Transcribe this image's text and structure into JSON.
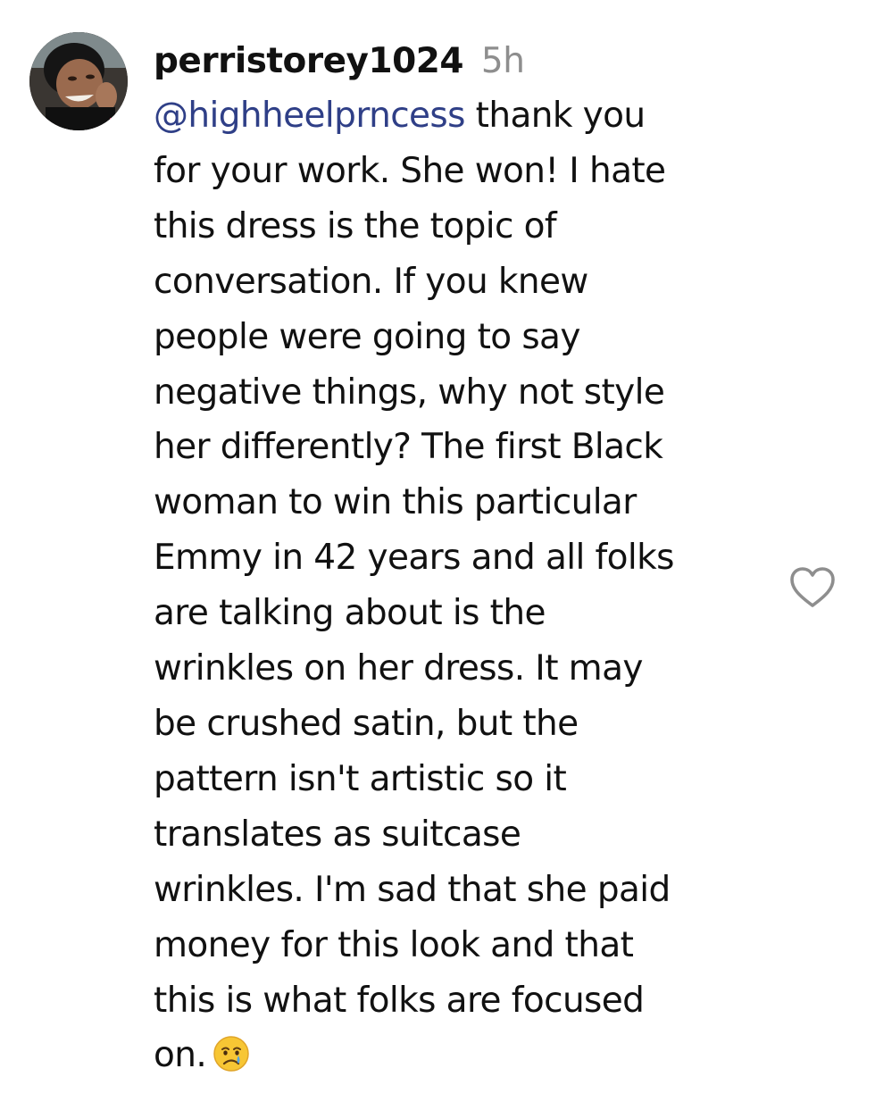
{
  "comment": {
    "username": "perristorey1024",
    "timestamp": "5h",
    "mention": "@highheelprncess",
    "lines": [
      " thank you",
      "for your work. She won! I hate",
      "this dress is the topic of",
      "conversation. If you knew",
      "people were going to say",
      "negative things, why not style",
      "her differently? The first Black",
      "woman to win this particular",
      "Emmy in 42 years and all folks",
      "are talking about is the",
      "wrinkles on her dress. It may",
      "be crushed satin, but the",
      "pattern isn't artistic so it",
      "translates as suitcase",
      "wrinkles. I'm sad that she paid",
      "money for this look and that",
      "this is what folks are focused",
      "on."
    ],
    "emoji": "crying-face-emoji",
    "like_icon": "heart-outline-icon"
  },
  "colors": {
    "text": "#111111",
    "timestamp": "#8e8e8e",
    "mention": "#2f3f87",
    "heart_stroke": "#8e8e8e",
    "background": "#ffffff"
  }
}
